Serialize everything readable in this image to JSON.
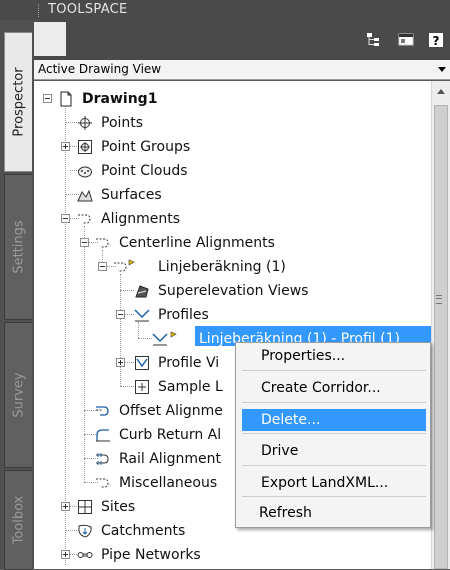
{
  "window": {
    "title": "TOOLSPACE"
  },
  "tabs": {
    "prospector": "Prospector",
    "settings": "Settings",
    "survey": "Survey",
    "toolbox": "Toolbox"
  },
  "view_select": {
    "value": "Active Drawing View"
  },
  "toolbar_icons": [
    "item-view-icon",
    "panel-icon",
    "help-icon"
  ],
  "tree": {
    "drawing": "Drawing1",
    "points": "Points",
    "point_groups": "Point Groups",
    "point_clouds": "Point Clouds",
    "surfaces": "Surfaces",
    "alignments": "Alignments",
    "centerline_alignments": "Centerline Alignments",
    "linjeberakning": "Linjeberäkning (1)",
    "superelevation_views": "Superelevation Views",
    "profiles": "Profiles",
    "profile_item": "Linjeberäkning (1) - Profil (1)",
    "profile_views": "Profile Vi",
    "sample_lines": "Sample L",
    "offset_alignments": "Offset Alignme",
    "curb_return": "Curb Return Al",
    "rail_alignments": "Rail Alignment",
    "miscellaneous": "Miscellaneous",
    "sites": "Sites",
    "catchments": "Catchments",
    "pipe_networks": "Pipe Networks"
  },
  "context_menu": {
    "properties": "Properties...",
    "create_corridor": "Create Corridor...",
    "delete": "Delete...",
    "drive": "Drive",
    "export_landxml": "Export LandXML...",
    "refresh": "Refresh",
    "highlighted": "Delete..."
  },
  "colors": {
    "selection": "#3399ff",
    "panel_dark": "#4a4a4a"
  }
}
